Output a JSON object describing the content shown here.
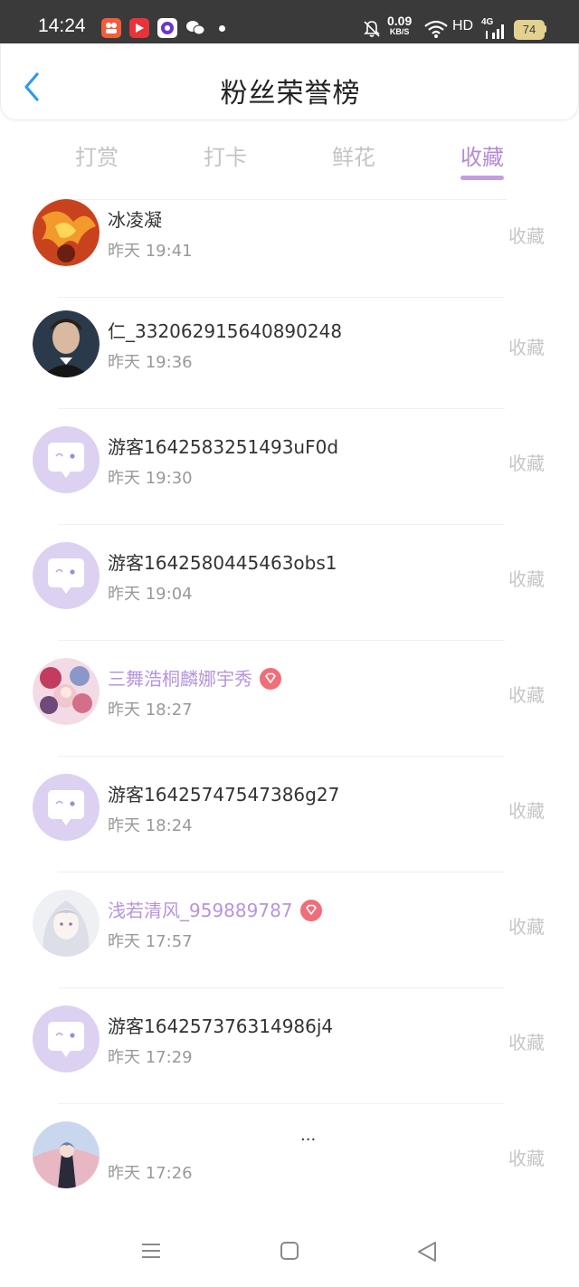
{
  "status_bar": {
    "time": "14:24",
    "net_speed": "0.09",
    "net_speed_unit": "KB/S",
    "hd": "HD",
    "network": "4G",
    "battery": "74"
  },
  "header": {
    "title": "粉丝荣誉榜"
  },
  "tabs": [
    {
      "label": "打赏"
    },
    {
      "label": "打卡"
    },
    {
      "label": "鲜花"
    },
    {
      "label": "收藏"
    }
  ],
  "active_tab": "收藏",
  "list": [
    {
      "name": "冰凌凝",
      "time": "昨天 19:41",
      "action": "收藏",
      "avatar": "phoenix",
      "vip": false
    },
    {
      "name": "仁_332062915640890248",
      "time": "昨天 19:36",
      "action": "收藏",
      "avatar": "man-portrait",
      "vip": false
    },
    {
      "name": "游客1642583251493uF0d",
      "time": "昨天 19:30",
      "action": "收藏",
      "avatar": "guest",
      "vip": false
    },
    {
      "name": "游客1642580445463obs1",
      "time": "昨天 19:04",
      "action": "收藏",
      "avatar": "guest",
      "vip": false
    },
    {
      "name": "三舞浩桐麟娜宇秀",
      "time": "昨天 18:27",
      "action": "收藏",
      "avatar": "anime-group",
      "vip": true
    },
    {
      "name": "游客16425747547386g27",
      "time": "昨天 18:24",
      "action": "收藏",
      "avatar": "guest",
      "vip": false
    },
    {
      "name": "浅若清风_959889787",
      "time": "昨天 17:57",
      "action": "收藏",
      "avatar": "anime-girl",
      "vip": true
    },
    {
      "name": "游客164257376314986j4",
      "time": "昨天 17:29",
      "action": "收藏",
      "avatar": "guest",
      "vip": false
    },
    {
      "name": "...",
      "time": "昨天 17:26",
      "action": "收藏",
      "avatar": "anime-boy",
      "vip": false
    }
  ],
  "colors": {
    "accent": "#b48ad4",
    "vip_name": "#b794dd",
    "vip_badge": "#f06e79",
    "back_arrow": "#2e9bea",
    "guest_avatar": "#ddd1f2"
  },
  "icons": {
    "back": "chevron-left-icon",
    "vip": "diamond-icon",
    "guest_avatar": "chat-bubble-icon",
    "nav_menu": "menu-icon",
    "nav_home": "square-icon",
    "nav_back": "triangle-back-icon"
  }
}
